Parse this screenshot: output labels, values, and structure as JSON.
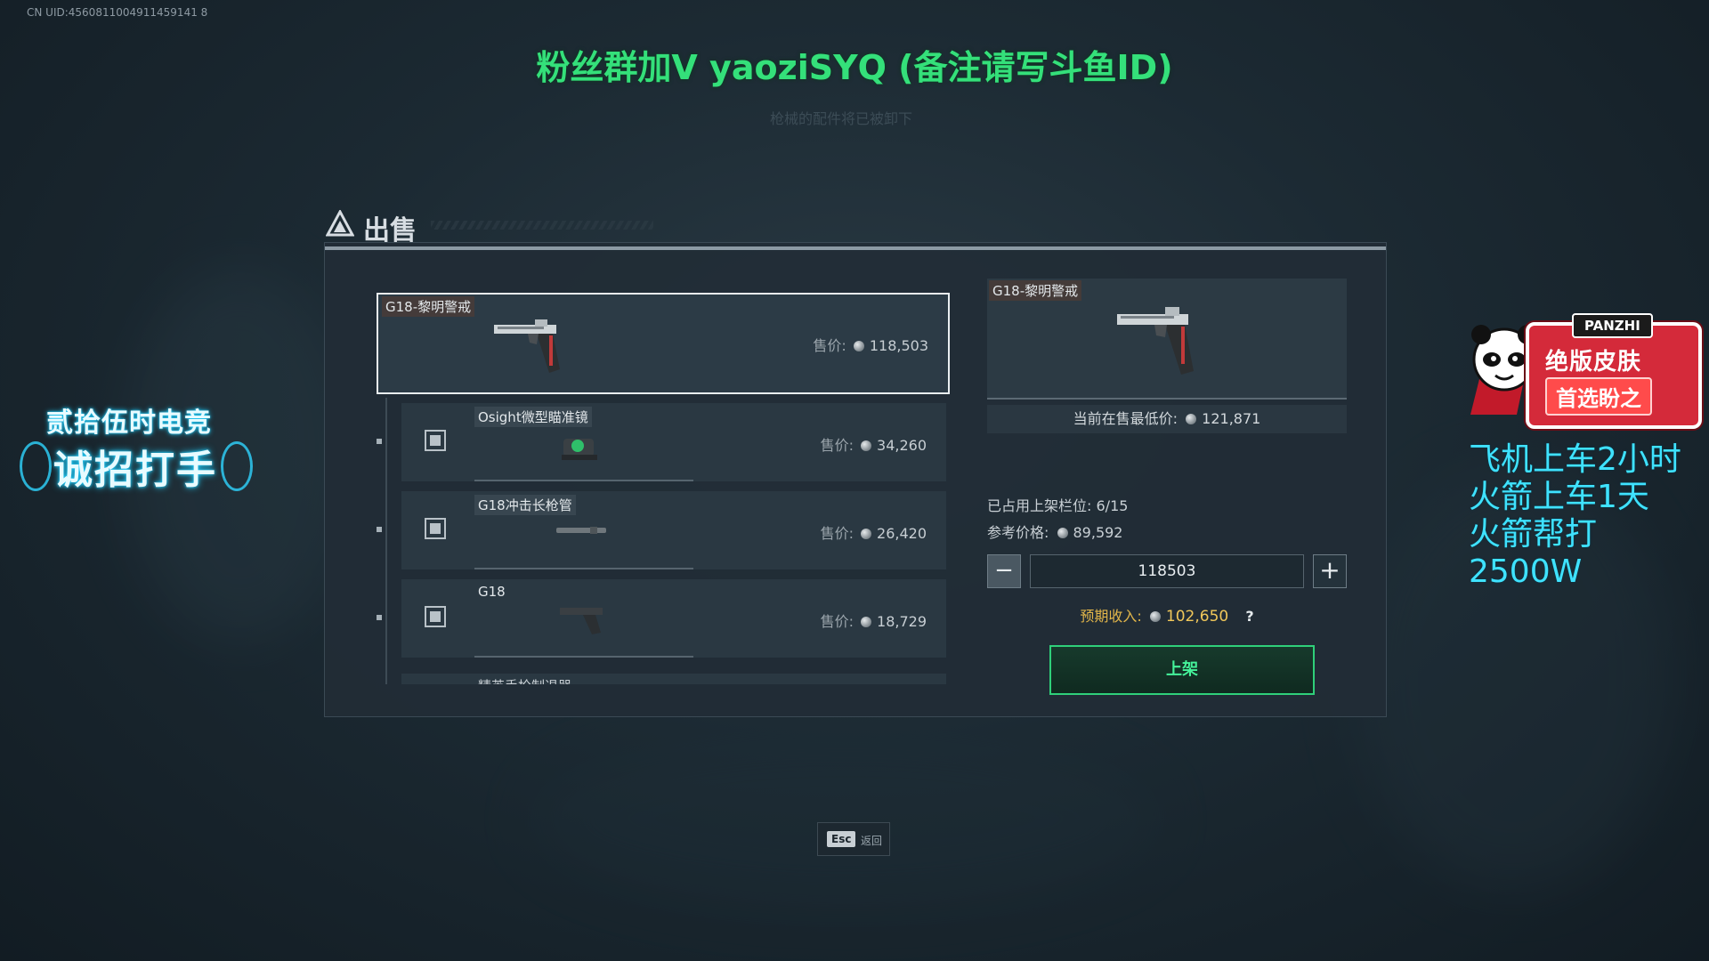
{
  "overlay": {
    "uid": "CN UID:4560811004911459141 8",
    "banner": "粉丝群加V yaoziSYQ (备注请写斗鱼ID)",
    "faint_hint": "枪械的配件将已被卸下",
    "promo_left_line1": "贰拾伍时电竞",
    "promo_left_line2": "诚招打手",
    "promo_right_tag": "PANZHI",
    "promo_right_line1": "绝版皮肤",
    "promo_right_line2": "首选盼之",
    "promo_right_text": [
      "飞机上车2小时",
      "火箭上车1天",
      "火箭帮打2500W"
    ]
  },
  "sell_panel": {
    "title": "出售",
    "price_prefix": "售价:",
    "main_item": {
      "name": "G18-黎明警戒",
      "price": "118,503"
    },
    "sub_items": [
      {
        "name": "Osight微型瞄准镜",
        "price": "34,260"
      },
      {
        "name": "G18冲击长枪管",
        "price": "26,420"
      },
      {
        "name": "G18",
        "price": "18,729"
      }
    ],
    "partial_item": {
      "name": "精英手枪制退器"
    }
  },
  "detail": {
    "name": "G18-黎明警戒",
    "lowest_label": "当前在售最低价:",
    "lowest_value": "121,871",
    "slots_label": "已占用上架栏位:",
    "slots_value": "6/15",
    "ref_label": "参考价格:",
    "ref_value": "89,592",
    "minus_symbol": "−",
    "plus_symbol": "+",
    "price_input": "118503",
    "income_label": "预期收入:",
    "income_value": "102,650",
    "help_symbol": "?",
    "list_button": "上架"
  },
  "esc": {
    "key": "Esc",
    "label": "返回"
  },
  "colors": {
    "accent_green": "#34e07a",
    "income_gold": "#f0c75a",
    "promo_cyan": "#3fe2ff"
  }
}
